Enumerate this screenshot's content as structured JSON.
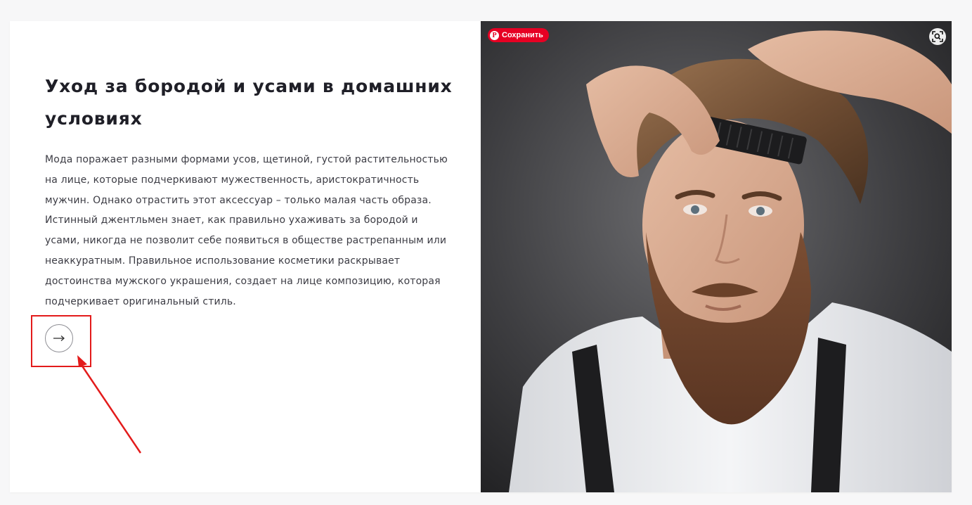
{
  "article": {
    "title": "Уход за бородой и усами в домашних условиях",
    "body": "Мода поражает разными формами усов, щетиной, густой растительностью на лице, которые подчеркивают мужественность, аристократичность мужчин. Однако отрастить этот аксессуар – только малая часть образа. Истинный джентльмен знает, как правильно ухаживать за бородой и усами, никогда не позволит себе появиться в обществе растрепанным или неаккуратным. Правильное использование косметики раскрывает достоинства мужского украшения, создает на лице композицию, которая подчеркивает оригинальный стиль.",
    "more_button_icon": "arrow-right-icon"
  },
  "image_overlay": {
    "pinterest_save_label": "Сохранить",
    "pinterest_icon": "pinterest-icon",
    "visual_search_icon": "lens-search-icon"
  },
  "annotation": {
    "highlight_color": "#e31b1b"
  },
  "colors": {
    "title": "#1f1f27",
    "body_text": "#3c3c44",
    "pinterest_red": "#e60023",
    "page_background": "#f7f7f8"
  }
}
